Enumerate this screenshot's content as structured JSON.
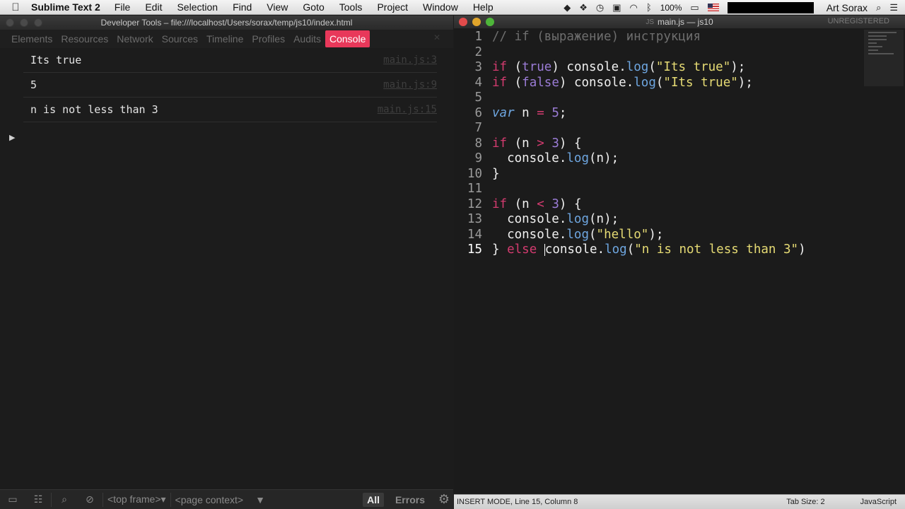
{
  "menubar": {
    "app_name": "Sublime Text 2",
    "items": [
      "File",
      "Edit",
      "Selection",
      "Find",
      "View",
      "Goto",
      "Tools",
      "Project",
      "Window",
      "Help"
    ],
    "battery": "100%",
    "user": "Art Sorax"
  },
  "devtools": {
    "title": "Developer Tools – file:///localhost/Users/sorax/temp/js10/index.html",
    "tabs": [
      "Elements",
      "Resources",
      "Network",
      "Sources",
      "Timeline",
      "Profiles",
      "Audits",
      "Console"
    ],
    "active_tab": "Console",
    "console_rows": [
      {
        "message": "Its true",
        "source": "main.js:3"
      },
      {
        "message": "5",
        "source": "main.js:9"
      },
      {
        "message": "n is not less than 3",
        "source": "main.js:15"
      }
    ],
    "statusbar": {
      "frame_select": "<top frame>▾",
      "context_select": "<page context>",
      "all_label": "All",
      "errors_label": "Errors"
    }
  },
  "editor": {
    "title": "main.js — js10",
    "tab_badge": "JS",
    "unregistered": "UNREGISTERED",
    "current_line": 15,
    "lines": [
      "// if (выражение) инструкция",
      "",
      "if (true) console.log(\"Its true\");",
      "if (false) console.log(\"Its true\");",
      "",
      "var n = 5;",
      "",
      "if (n > 3) {",
      "  console.log(n);",
      "}",
      "",
      "if (n < 3) {",
      "  console.log(n);",
      "  console.log(\"hello\");",
      "} else console.log(\"n is not less than 3\")"
    ],
    "statusbar": {
      "mode": "INSERT MODE, Line 15, Column 8",
      "tab_size": "Tab Size: 2",
      "syntax": "JavaScript"
    }
  },
  "colors": {
    "console_tab_active": "#e8385a",
    "keyword": "#d33b6f",
    "function": "#6ea6e0",
    "string": "#e6db74",
    "number": "#9b7cd6"
  }
}
